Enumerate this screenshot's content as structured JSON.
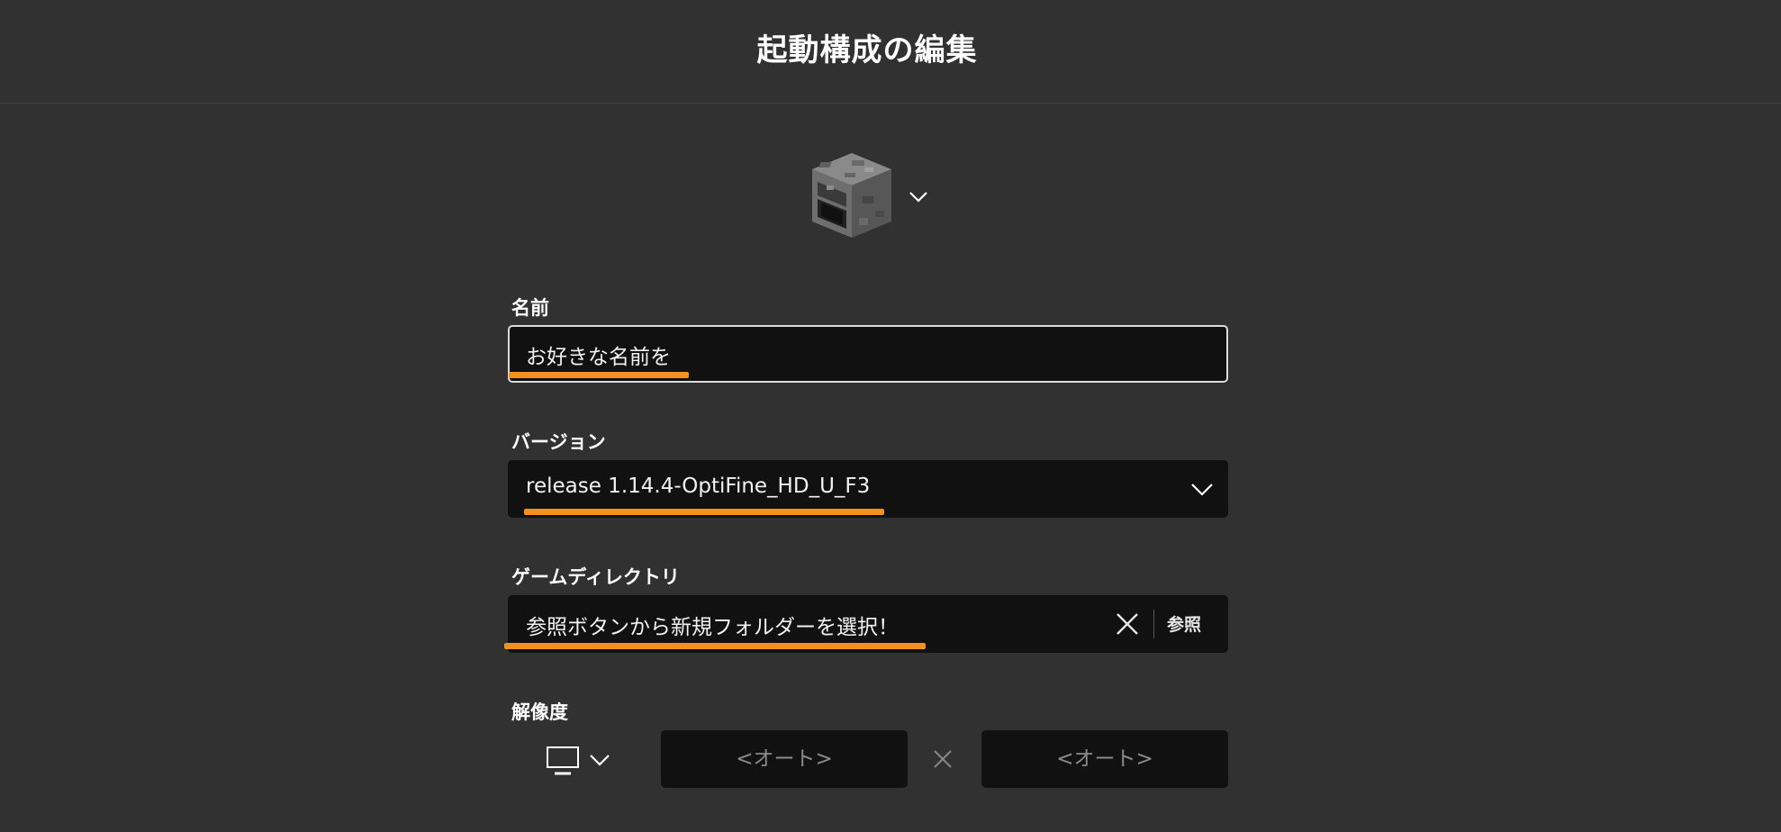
{
  "header": {
    "title": "起動構成の編集"
  },
  "icon_picker": {
    "icon": "furnace-block-icon"
  },
  "name": {
    "label": "名前",
    "value": "お好きな名前を"
  },
  "version": {
    "label": "バージョン",
    "value": "release 1.14.4-OptiFine_HD_U_F3"
  },
  "game_directory": {
    "label": "ゲームディレクトリ",
    "value": "参照ボタンから新規フォルダーを選択！",
    "browse_label": "参照"
  },
  "resolution": {
    "label": "解像度",
    "width_placeholder": "<オート>",
    "height_placeholder": "<オート>"
  },
  "colors": {
    "background": "#313131",
    "field": "#111111",
    "highlight_underline": "#f4901e"
  }
}
